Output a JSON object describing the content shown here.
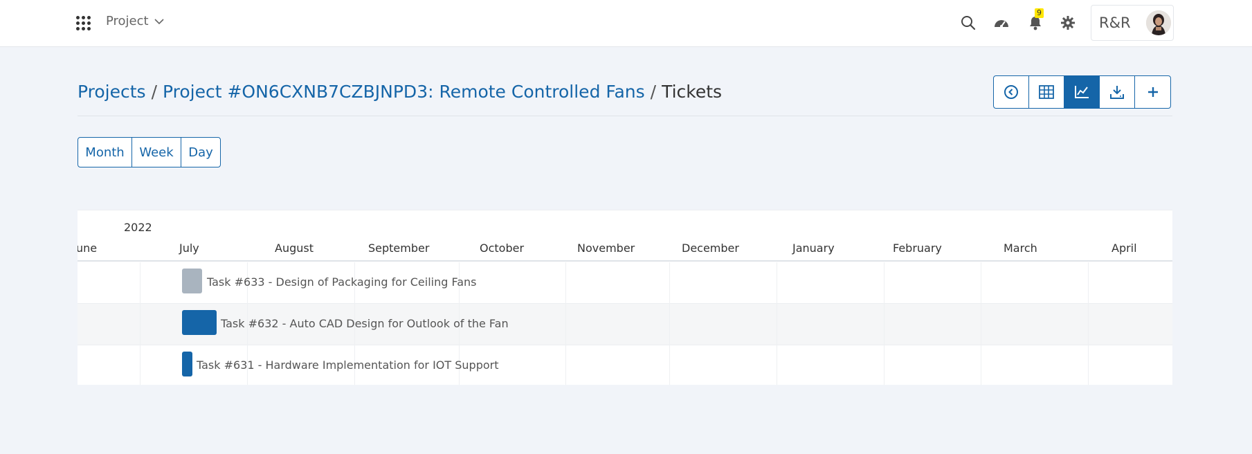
{
  "topbar": {
    "project_menu_label": "Project",
    "notification_count": "9",
    "user_initials": "R&R"
  },
  "breadcrumb": {
    "projects": "Projects",
    "separator": "/",
    "project": "Project #ON6CXNB7CZBJNPD3: Remote Controlled Fans",
    "current": "Tickets"
  },
  "toolbar": {
    "icons": [
      "back-icon",
      "table-icon",
      "chart-icon",
      "download-icon",
      "plus-icon"
    ],
    "active": "chart-icon"
  },
  "view_switch": [
    "Month",
    "Week",
    "Day"
  ],
  "gantt": {
    "year": "2022",
    "months": [
      "une",
      "July",
      "August",
      "September",
      "October",
      "November",
      "December",
      "January",
      "February",
      "March",
      "April"
    ],
    "tasks": [
      {
        "label": "Task #633 - Design of Packaging for Ceiling Fans",
        "color": "#a9b4bf"
      },
      {
        "label": "Task #632 - Auto CAD Design for Outlook of the Fan",
        "color": "#1565a8"
      },
      {
        "label": "Task #631 - Hardware Implementation for IOT Support",
        "color": "#1565a8"
      }
    ]
  },
  "colors": {
    "accent": "#1565a8",
    "page_bg": "#f1f4f9",
    "badge": "#ffe600"
  }
}
